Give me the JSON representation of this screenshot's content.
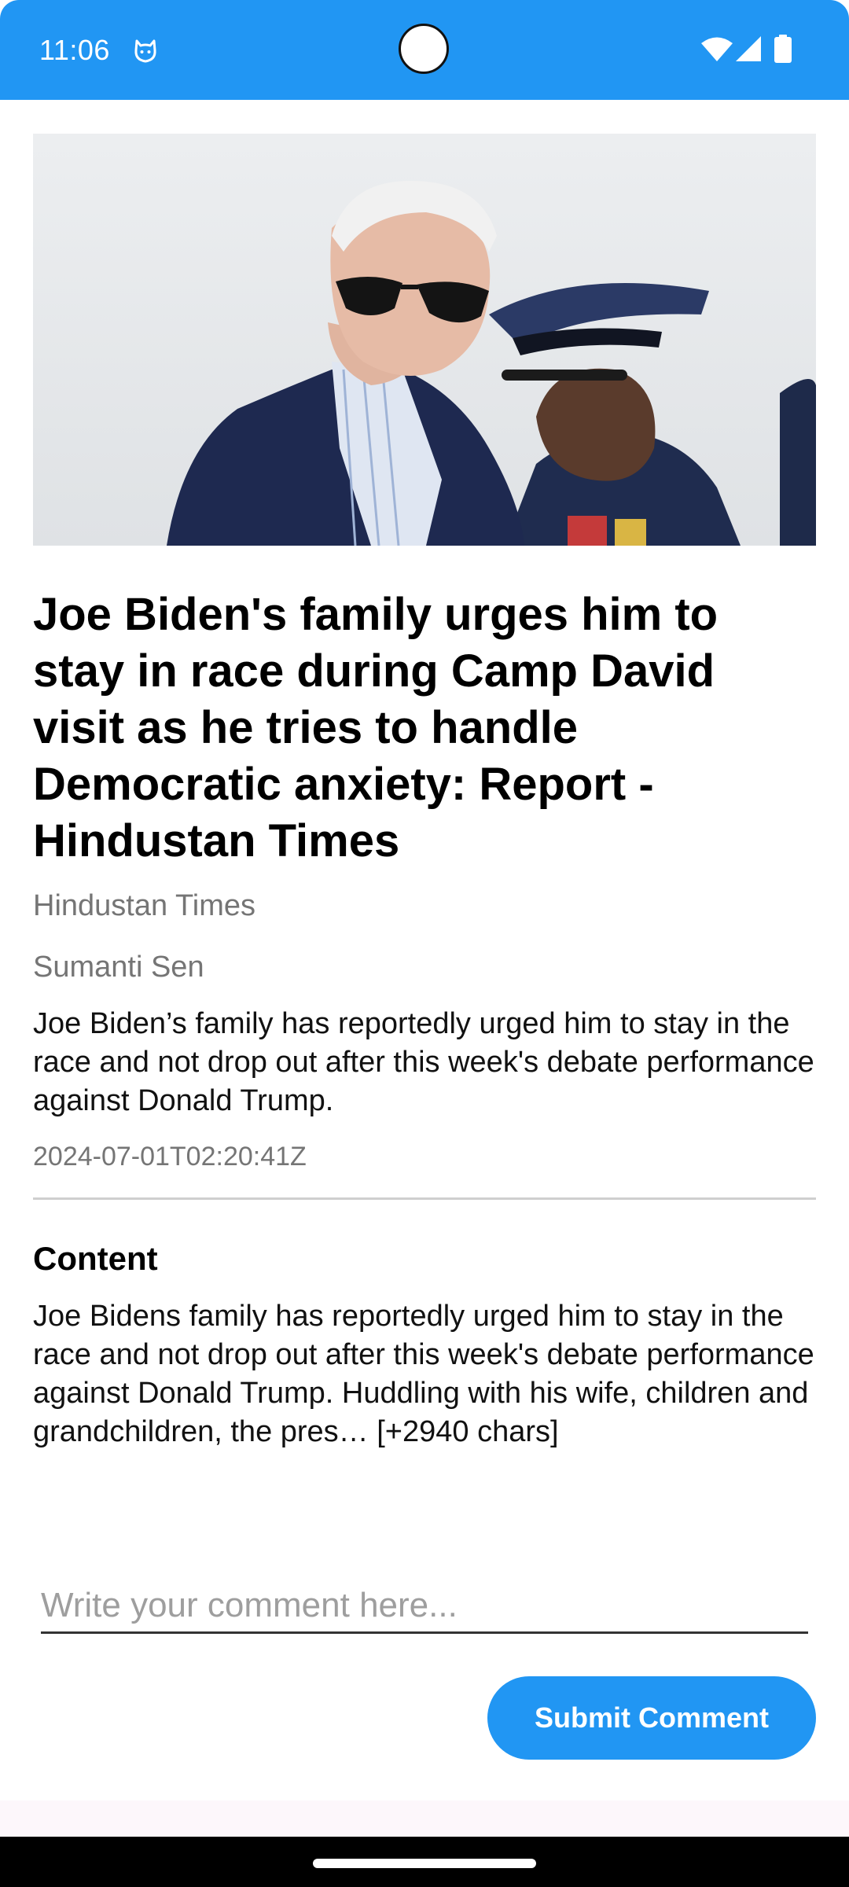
{
  "status_bar": {
    "time": "11:06",
    "color": "#2196F3",
    "icons": [
      "cat-notification-icon",
      "wifi-icon",
      "signal-icon",
      "battery-icon"
    ]
  },
  "article": {
    "image_alt": "Joe Biden with military officer",
    "title": "Joe Biden's family urges him to stay in race during Camp David visit as he tries to handle Democratic anxiety: Report - Hindustan Times",
    "source": "Hindustan Times",
    "author": "Sumanti Sen",
    "description": "Joe Biden’s family has reportedly urged him to stay in the race and not drop out after this week's debate performance against Donald Trump.",
    "published_at": "2024-07-01T02:20:41Z"
  },
  "content_section": {
    "heading": "Content",
    "body": "Joe Bidens family has reportedly urged him to stay in the race and not drop out after this week's debate performance against Donald Trump. Huddling with his wife, children and grandchildren, the pres… [+2940 chars]"
  },
  "comment": {
    "value": "",
    "placeholder": "Write your comment here..."
  },
  "submit_button": {
    "label": "Submit Comment",
    "color": "#2196F3"
  }
}
